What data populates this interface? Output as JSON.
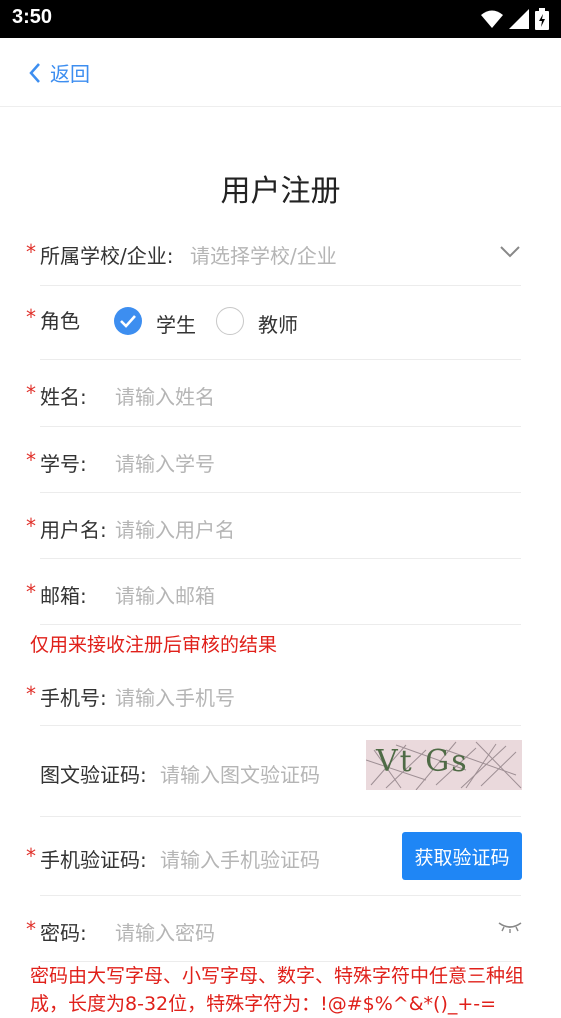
{
  "status": {
    "time": "3:50"
  },
  "nav": {
    "back_label": "返回"
  },
  "title": "用户注册",
  "form": {
    "required_mark": "*",
    "school": {
      "label": "所属学校/企业:",
      "placeholder": "请选择学校/企业"
    },
    "role": {
      "label": "角色",
      "options": [
        "学生",
        "教师"
      ],
      "selected": "学生"
    },
    "name": {
      "label": "姓名:",
      "placeholder": "请输入姓名"
    },
    "student_id": {
      "label": "学号:",
      "placeholder": "请输入学号"
    },
    "username": {
      "label": "用户名:",
      "placeholder": "请输入用户名"
    },
    "email": {
      "label": "邮箱:",
      "placeholder": "请输入邮箱",
      "note": "仅用来接收注册后审核的结果"
    },
    "phone": {
      "label": "手机号:",
      "placeholder": "请输入手机号"
    },
    "captcha": {
      "label": "图文验证码:",
      "placeholder": "请输入图文验证码",
      "image_text": "Vt Gs"
    },
    "sms_code": {
      "label": "手机验证码:",
      "placeholder": "请输入手机验证码",
      "button": "获取验证码"
    },
    "password": {
      "label": "密码:",
      "placeholder": "请输入密码",
      "note": "密码由大写字母、小写字母、数字、特殊字符中任意三种组成，长度为8-32位，特殊字符为：!@#$%^&*()_+-="
    }
  },
  "colors": {
    "accent": "#3d8ef0",
    "required": "#e0302a",
    "note": "#e0201a",
    "button": "#1f86f5"
  }
}
